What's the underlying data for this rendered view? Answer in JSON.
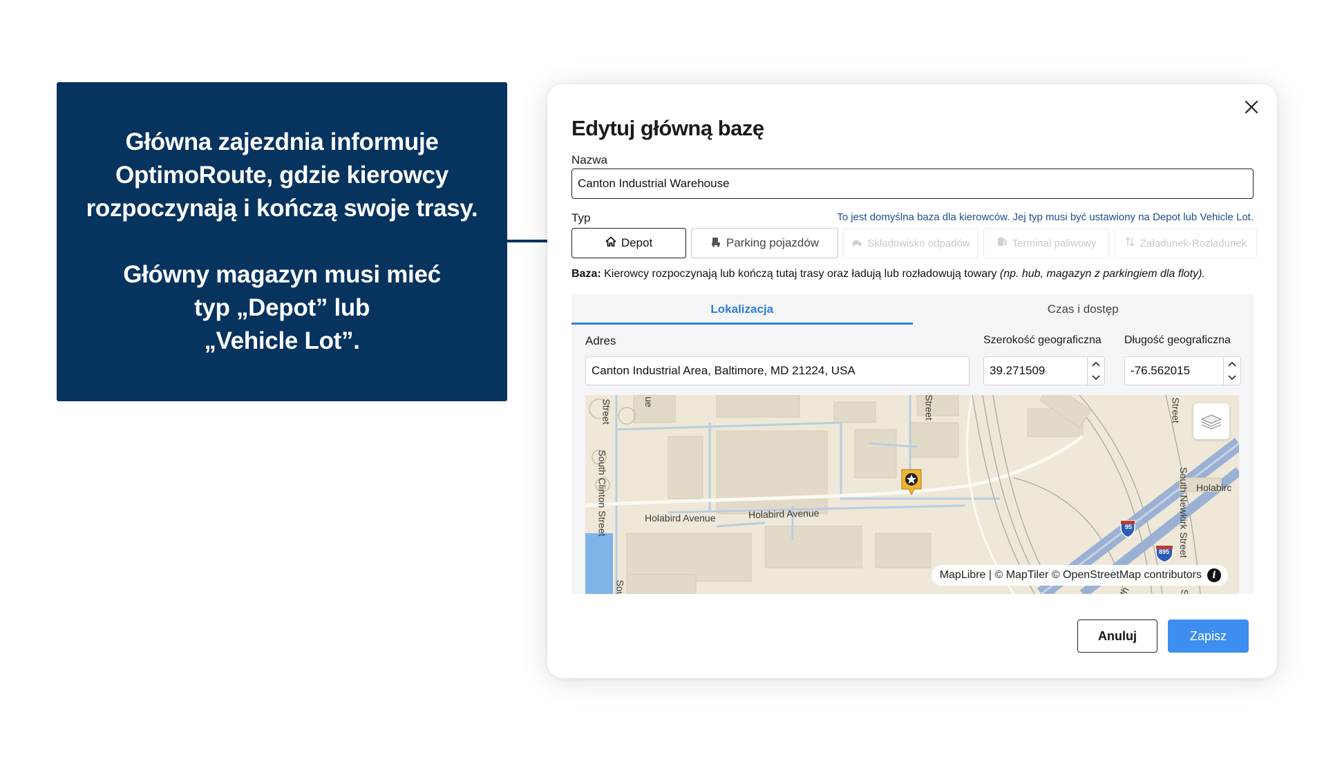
{
  "callout": {
    "paragraph1": "Główna zajezdnia informuje\nOptimoRoute, gdzie kierowcy\nrozpoczynają i kończą swoje trasy.",
    "paragraph2": "Główny magazyn musi mieć\ntyp „Depot” lub\n„Vehicle Lot”."
  },
  "modal": {
    "title": "Edytuj główną bazę",
    "name_label": "Nazwa",
    "name_value": "Canton Industrial Warehouse",
    "type_label": "Typ",
    "type_hint": "To jest domyślna baza dla kierowców. Jej typ musi być ustawiony na Depot lub Vehicle Lot.",
    "types": [
      {
        "label": "Depot",
        "icon": "home-icon",
        "state": "active"
      },
      {
        "label": "Parking pojazdów",
        "icon": "car-icon",
        "state": "enabled"
      },
      {
        "label": "Składowisko odpadów",
        "icon": "dump-truck-icon",
        "state": "disabled"
      },
      {
        "label": "Terminal paliwowy",
        "icon": "fuel-pump-icon",
        "state": "disabled"
      },
      {
        "label": "Załadunek-Rozładunek",
        "icon": "up-down-arrows-icon",
        "state": "disabled"
      }
    ],
    "base_desc_bold": "Baza:",
    "base_desc": " Kierowcy rozpoczynają lub kończą tutaj trasy oraz ładują lub rozładowują towary ",
    "base_desc_italic": "(np. hub, magazyn z parkingiem dla floty).",
    "tabs": [
      {
        "label": "Lokalizacja",
        "active": true
      },
      {
        "label": "Czas i dostęp",
        "active": false
      }
    ],
    "address_label": "Adres",
    "address_value": "Canton Industrial Area, Baltimore, MD 21224, USA",
    "lat_label": "Szerokość geograficzna",
    "lat_value": "39.271509",
    "lng_label": "Długość geograficzna",
    "lng_value": "-76.562015",
    "map": {
      "labels": {
        "holabird1": "Holabird Avenue",
        "holabird2": "Holabird Avenue",
        "holabird3": "Holabirc",
        "clinton": "South Clinton Street",
        "newkirk": "South Newkirk Street",
        "street_a": "Street",
        "street_b": "Street",
        "street_c": "Street",
        "frag_ue": "ue",
        "frag_sout": "Sout",
        "frag_s": "S",
        "frag_th": "th",
        "i95": "95",
        "i895": "895"
      },
      "attribution": "MapLibre | © MapTiler © OpenStreetMap contributors",
      "marker_icon": "depot-star-marker-icon",
      "layers_icon": "layers-icon"
    },
    "cancel_label": "Anuluj",
    "save_label": "Zapisz"
  }
}
